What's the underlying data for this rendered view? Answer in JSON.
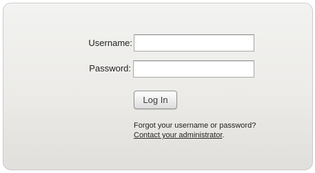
{
  "login_form": {
    "username_label": "Username:",
    "username_value": "",
    "password_label": "Password:",
    "password_value": "",
    "login_button_label": "Log In"
  },
  "help": {
    "forgot_text": "Forgot your username or password?",
    "contact_link_text": "Contact your administrator",
    "contact_suffix": "."
  }
}
